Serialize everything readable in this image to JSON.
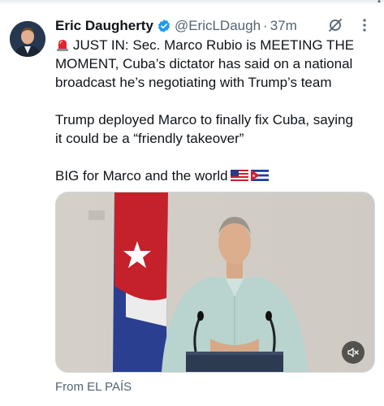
{
  "tweet": {
    "author_name": "Eric Daugherty",
    "handle": "@EricLDaugh",
    "separator": "·",
    "time": "37m",
    "line1": "JUST IN: Sec. Marco Rubio is MEETING THE",
    "line2": "MOMENT, Cuba’s dictator has said on a national",
    "line3": "broadcast he’s negotiating with Trump’s team",
    "line4": "Trump deployed Marco to finally fix Cuba, saying",
    "line5": "it could be a “friendly takeover”",
    "line6": "BIG for Marco and the world",
    "source": "From EL PAÍS"
  },
  "icons": {
    "verified": "verified-badge-icon",
    "grok": "grok-icon",
    "more": "more-options-icon",
    "siren": "siren-emoji",
    "mute": "mute-icon",
    "flags": [
      "us-flag-emoji",
      "cuba-flag-emoji"
    ]
  },
  "colors": {
    "verified_blue": "#1d9bf0",
    "text_primary": "#0f1419",
    "text_secondary": "#536471"
  }
}
